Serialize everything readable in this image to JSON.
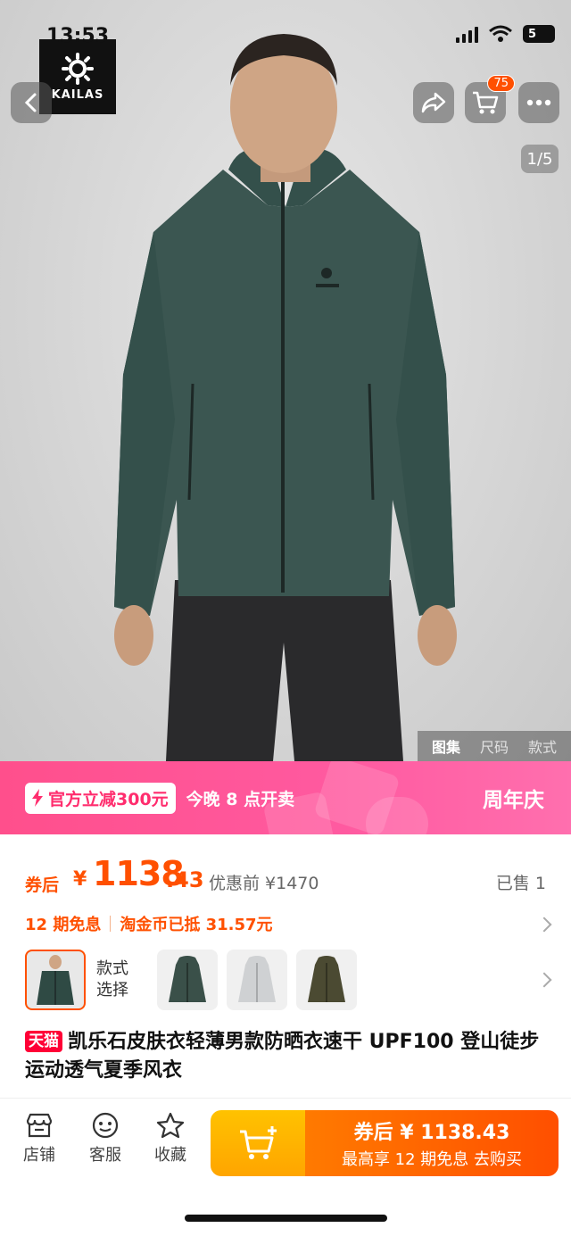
{
  "status_bar": {
    "time": "13:53",
    "battery": "5"
  },
  "brand": {
    "logo_text": "KAILAS"
  },
  "top_nav": {
    "back_icon": "chevron-left-icon",
    "share_icon": "share-icon",
    "cart_icon": "cart-icon",
    "cart_badge": "75",
    "more_icon": "more-icon"
  },
  "gallery": {
    "indicator": "1/5",
    "tabs": [
      {
        "label": "图集",
        "active": true
      },
      {
        "label": "尺码",
        "active": false
      },
      {
        "label": "款式",
        "active": false
      }
    ]
  },
  "promo": {
    "discount": "官方立减300元",
    "time": "今晚 8 点开卖",
    "event": "周年庆",
    "colors": {
      "bg": "#ff4f8c",
      "accent": "#ff2d6e"
    }
  },
  "price": {
    "prefix": "券后",
    "currency": "¥",
    "integer": "1138",
    "decimal": ".43",
    "original": "优惠前 ¥1470",
    "sold": "已售 1",
    "color": "#ff5000"
  },
  "benefits": {
    "installment": "12 期免息",
    "coins": "淘金币已抵 31.57元"
  },
  "variants": {
    "label_line1": "款式",
    "label_line2": "选择",
    "colors": [
      "#2f4a44",
      "#3a5049",
      "#cfd1d3",
      "#4b4a32"
    ]
  },
  "product": {
    "badge": "天猫",
    "title": "凯乐石皮肤衣轻薄男款防晒衣速干 UPF100 登山徒步运动透气夏季风衣"
  },
  "bottom_bar": {
    "store": "店铺",
    "service": "客服",
    "favorite": "收藏",
    "buy_line1": "券后 ¥ 1138.43",
    "buy_line2": "最高享 12 期免息  去购买"
  }
}
